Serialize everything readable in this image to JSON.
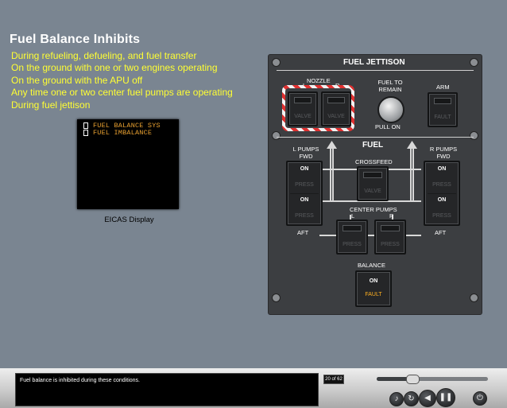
{
  "page_title": "Fuel Balance Inhibits",
  "conditions": [
    "During refueling, defueling, and fuel transfer",
    "On the ground with one or two engines operating",
    "On the ground with the APU off",
    "Any time one or two center fuel pumps are operating",
    "During fuel jettison"
  ],
  "eicas": {
    "messages": [
      "FUEL BALANCE SYS",
      "FUEL IMBALANCE"
    ],
    "label": "EICAS Display"
  },
  "panel": {
    "jettison_title": "FUEL JETTISON",
    "nozzle_label": "NOZZLE",
    "nozzle_l": "L",
    "nozzle_r": "R",
    "valve_label": "VALVE",
    "fuel_to_remain": "FUEL TO\nREMAIN",
    "pull_on": "PULL ON",
    "arm": "ARM",
    "fault": "FAULT",
    "fuel_title": "FUEL",
    "l_pumps": "L PUMPS\nFWD",
    "r_pumps": "R PUMPS\nFWD",
    "crossfeed": "CROSSFEED",
    "center_pumps": "CENTER PUMPS",
    "center_l": "L",
    "center_r": "R",
    "aft": "AFT",
    "on": "ON",
    "press": "PRESS",
    "balance": "BALANCE"
  },
  "footer": {
    "caption": "Fuel balance is inhibited during these conditions.",
    "page": "20 of 62",
    "progress_fraction": 0.32
  },
  "colors": {
    "background": "#7a8591",
    "yellow_text": "#ffff33",
    "amber": "#ffb020"
  }
}
